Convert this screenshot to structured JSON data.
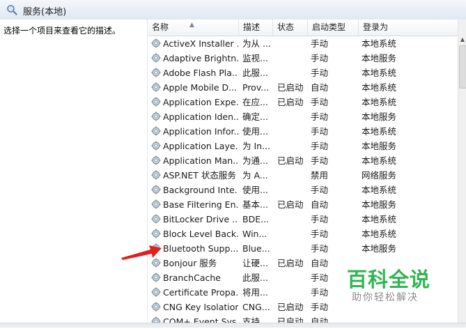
{
  "window": {
    "title": "服务(本地)"
  },
  "description_pane": {
    "text": "选择一个项目来查看它的描述。"
  },
  "columns": [
    "名称",
    "描述",
    "状态",
    "启动类型",
    "登录为"
  ],
  "services": [
    {
      "name": "ActiveX Installer ...",
      "desc": "为从 ...",
      "status": "",
      "startup": "手动",
      "logon": "本地系统"
    },
    {
      "name": "Adaptive Brightn...",
      "desc": "监视...",
      "status": "",
      "startup": "手动",
      "logon": "本地服务"
    },
    {
      "name": "Adobe Flash Pla...",
      "desc": "此服...",
      "status": "",
      "startup": "手动",
      "logon": "本地系统"
    },
    {
      "name": "Apple Mobile D...",
      "desc": "Prov...",
      "status": "已启动",
      "startup": "自动",
      "logon": "本地系统"
    },
    {
      "name": "Application Expe...",
      "desc": "在应...",
      "status": "已启动",
      "startup": "手动",
      "logon": "本地系统"
    },
    {
      "name": "Application Iden...",
      "desc": "确定...",
      "status": "",
      "startup": "手动",
      "logon": "本地服务"
    },
    {
      "name": "Application Infor...",
      "desc": "使用...",
      "status": "",
      "startup": "手动",
      "logon": "本地系统"
    },
    {
      "name": "Application Laye...",
      "desc": "为 In...",
      "status": "",
      "startup": "手动",
      "logon": "本地服务"
    },
    {
      "name": "Application Man...",
      "desc": "为通...",
      "status": "已启动",
      "startup": "手动",
      "logon": "本地系统"
    },
    {
      "name": "ASP.NET 状态服务",
      "desc": "为 A...",
      "status": "",
      "startup": "禁用",
      "logon": "网络服务"
    },
    {
      "name": "Background Inte...",
      "desc": "使用...",
      "status": "",
      "startup": "手动",
      "logon": "本地系统"
    },
    {
      "name": "Base Filtering En...",
      "desc": "基本...",
      "status": "已启动",
      "startup": "自动",
      "logon": "本地服务"
    },
    {
      "name": "BitLocker Drive ...",
      "desc": "BDE...",
      "status": "",
      "startup": "手动",
      "logon": "本地系统"
    },
    {
      "name": "Block Level Back...",
      "desc": "Win...",
      "status": "",
      "startup": "手动",
      "logon": "本地系统"
    },
    {
      "name": "Bluetooth Supp...",
      "desc": "Blue...",
      "status": "",
      "startup": "手动",
      "logon": "本地服务"
    },
    {
      "name": "Bonjour 服务",
      "desc": "让硬...",
      "status": "已启动",
      "startup": "自动",
      "logon": ""
    },
    {
      "name": "BranchCache",
      "desc": "此服...",
      "status": "",
      "startup": "手动",
      "logon": ""
    },
    {
      "name": "Certificate Propa...",
      "desc": "将用...",
      "status": "",
      "startup": "手动",
      "logon": ""
    },
    {
      "name": "CNG Key Isolation",
      "desc": "CNG...",
      "status": "已启动",
      "startup": "手动",
      "logon": ""
    },
    {
      "name": "COM+ Event Sys...",
      "desc": "支持...",
      "status": "已启动",
      "startup": "自动",
      "logon": ""
    }
  ],
  "watermark": {
    "main": "百科全说",
    "sub": "助你轻松解决"
  },
  "colors": {
    "watermark": "#2fb552",
    "annotation_arrow": "#e02020"
  }
}
